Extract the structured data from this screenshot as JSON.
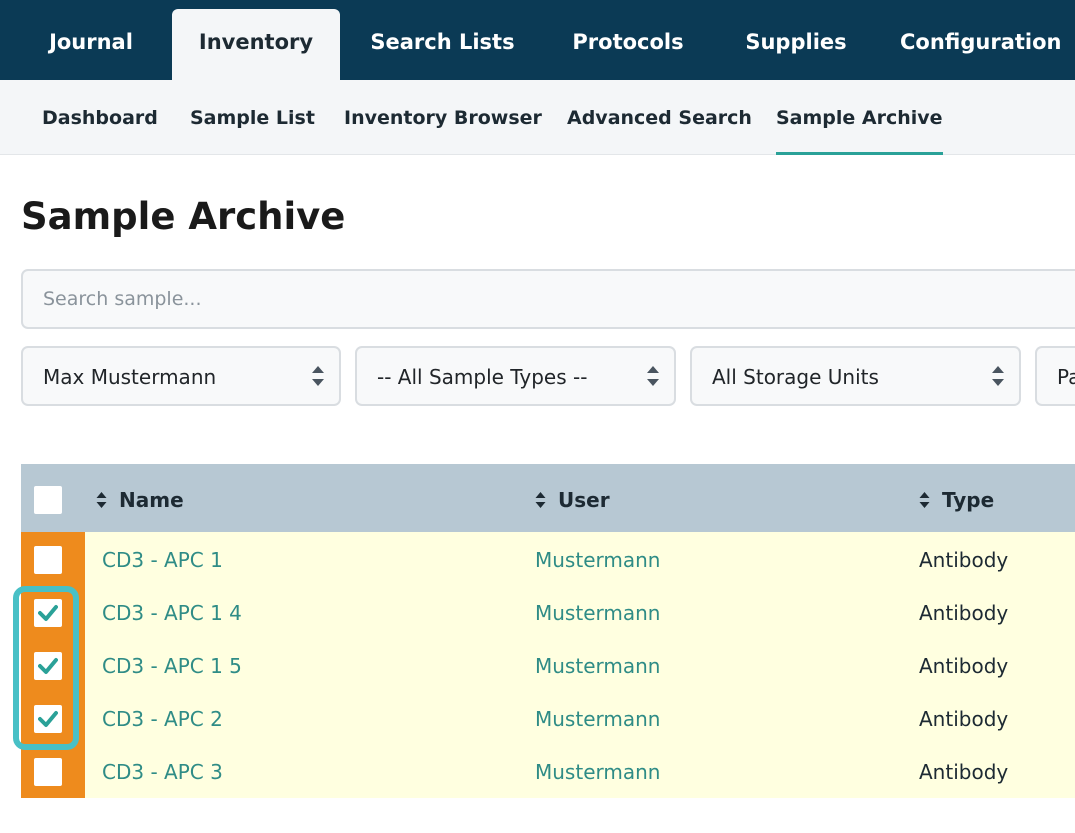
{
  "top_tabs": [
    "Journal",
    "Inventory",
    "Search Lists",
    "Protocols",
    "Supplies",
    "Configuration"
  ],
  "sub_tabs": [
    "Dashboard",
    "Sample List",
    "Inventory Browser",
    "Advanced Search",
    "Sample Archive"
  ],
  "title": "Sample Archive",
  "search": {
    "placeholder": "Search sample..."
  },
  "filters": {
    "user": "Max Mustermann",
    "sample_type": "-- All Sample Types --",
    "storage": "All Storage Units",
    "partial": "Pa"
  },
  "table": {
    "columns": [
      "Name",
      "User",
      "Type"
    ],
    "rows": [
      {
        "name": "CD3 - APC 1",
        "user": "Mustermann",
        "type": "Antibody",
        "checked": false
      },
      {
        "name": "CD3 - APC 1 4",
        "user": "Mustermann",
        "type": "Antibody",
        "checked": true
      },
      {
        "name": "CD3 - APC 1 5",
        "user": "Mustermann",
        "type": "Antibody",
        "checked": true
      },
      {
        "name": "CD3 - APC 2",
        "user": "Mustermann",
        "type": "Antibody",
        "checked": true
      },
      {
        "name": "CD3 - APC 3",
        "user": "Mustermann",
        "type": "Antibody",
        "checked": false
      }
    ]
  },
  "colors": {
    "nav": "#0b3a55",
    "accent": "#2aa198",
    "link": "#2f8c86",
    "selection": "#ee8b1d",
    "row_bg": "#ffffe0",
    "highlight": "#48c0c6"
  }
}
